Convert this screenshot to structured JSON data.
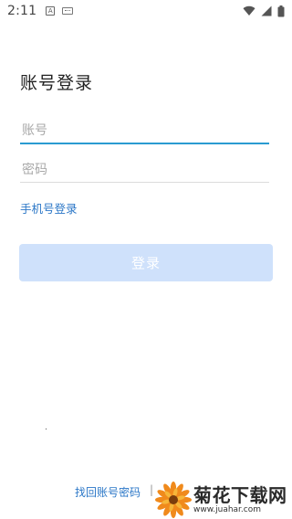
{
  "status_bar": {
    "time": "2:11",
    "notif_a_letter": "A",
    "icons": [
      "notification-a-icon",
      "keyboard-icon",
      "wifi-icon",
      "signal-icon",
      "battery-icon"
    ]
  },
  "page": {
    "title": "账号登录"
  },
  "form": {
    "account_placeholder": "账号",
    "password_placeholder": "密码",
    "phone_login_label": "手机号登录",
    "login_button_label": "登录"
  },
  "footer": {
    "find_account_label": "找回账号密码",
    "separator": "|"
  },
  "watermark": {
    "title": "菊花下载网",
    "url": "www.juahar.com"
  },
  "colors": {
    "accent": "#2a9bd1",
    "link": "#2b77c7",
    "button_disabled_bg": "#cfe1fb"
  }
}
